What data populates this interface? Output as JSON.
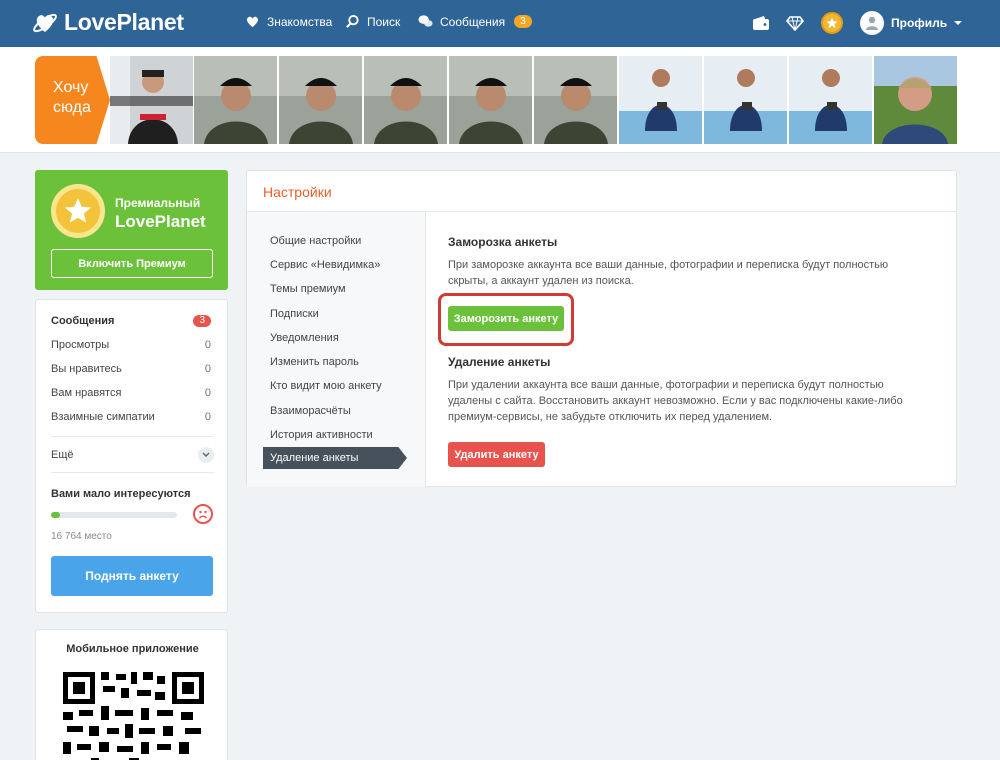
{
  "app": {
    "name": "LovePlanet"
  },
  "nav": {
    "dating": "Знакомства",
    "search": "Поиск",
    "messages": "Сообщения",
    "messages_count": "3",
    "profile": "Профиль"
  },
  "strip": {
    "want_here": "Хочу\nсюда"
  },
  "premium": {
    "line1": "Премиальный",
    "line2": "LovePlanet",
    "button": "Включить Премиум"
  },
  "stats": {
    "messages_label": "Сообщения",
    "messages_count": "3",
    "rows": [
      {
        "label": "Просмотры",
        "value": "0"
      },
      {
        "label": "Вы нравитесь",
        "value": "0"
      },
      {
        "label": "Вам нравятся",
        "value": "0"
      },
      {
        "label": "Взаимные симпатии",
        "value": "0"
      }
    ],
    "more": "Ещё"
  },
  "rating": {
    "title": "Вами мало интересуются",
    "progress_percent": 7,
    "place": "16 764 место",
    "button": "Поднять анкету"
  },
  "mobile": {
    "title": "Мобильное приложение"
  },
  "settings": {
    "title": "Настройки",
    "menu": [
      "Общие настройки",
      "Сервис «Невидимка»",
      "Темы премиум",
      "Подписки",
      "Уведомления",
      "Изменить пароль",
      "Кто видит мою анкету",
      "Взаиморасчёты",
      "История активности"
    ],
    "active": "Удаление анкеты",
    "freeze": {
      "title": "Заморозка анкеты",
      "text": "При заморозке аккаунта все ваши данные, фотографии и переписка будут полностью скрыты, а аккаунт удален из поиска.",
      "button": "Заморозить анкету"
    },
    "delete": {
      "title": "Удаление анкеты",
      "text": "При удалении аккаунта все ваши данные, фотографии и переписка будут полностью удалены с сайта. Восстановить аккаунт невозможно. Если у вас подключены какие-либо премиум-сервисы, не забудьте отключить их перед удалением.",
      "button": "Удалить анкету"
    }
  },
  "colors": {
    "topbar": "#2f6497",
    "accent_orange": "#f6871f",
    "green": "#6cc13b",
    "red": "#e8534d",
    "blue_button": "#4aa4ea"
  }
}
